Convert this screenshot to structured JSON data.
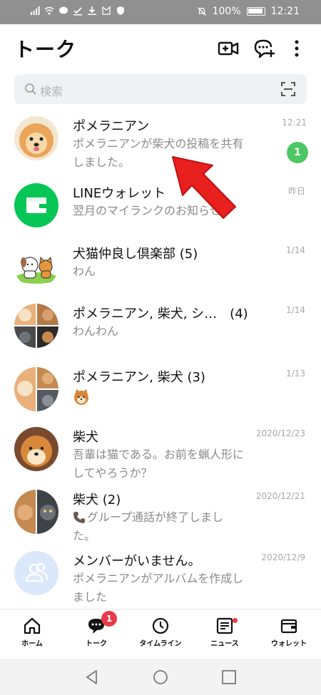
{
  "status_bar": {
    "battery": "100%",
    "time": "12:21"
  },
  "header": {
    "title": "トーク"
  },
  "search": {
    "placeholder": "検索"
  },
  "chats": [
    {
      "name": "ポメラニアン",
      "message": "ポメラニアンが柴犬の投稿を共有しました。",
      "time": "12:21",
      "unread": "1"
    },
    {
      "name": "LINEウォレット",
      "message": "翌月のマイランクのお知らせ",
      "time": "昨日"
    },
    {
      "name": "犬猫仲良し倶楽部 (5)",
      "message": "わん",
      "time": "1/14"
    },
    {
      "name": "ポメラニアン, 柴犬, シ…　(4)",
      "message": "わんわん",
      "time": "1/14"
    },
    {
      "name": "ポメラニアン, 柴犬 (3)",
      "message": "",
      "time": "1/13"
    },
    {
      "name": "柴犬",
      "message": "吾輩は猫である。お前を蝋人形にしてやろうか？",
      "time": "2020/12/23"
    },
    {
      "name": "柴犬 (2)",
      "message": "グループ通話が終了しました。",
      "time": "2020/12/21"
    },
    {
      "name": "メンバーがいません。",
      "message": "ポメラニアンがアルバムを作成しました",
      "time": "2020/12/9"
    }
  ],
  "tabs": [
    {
      "label": "ホーム"
    },
    {
      "label": "トーク",
      "badge": "1"
    },
    {
      "label": "タイムライン"
    },
    {
      "label": "ニュース"
    },
    {
      "label": "ウォレット"
    }
  ],
  "colors": {
    "line_green": "#06c755",
    "badge_red": "#e83c4a",
    "unread_green": "#4cc764",
    "arrow_red": "#e8201e"
  }
}
